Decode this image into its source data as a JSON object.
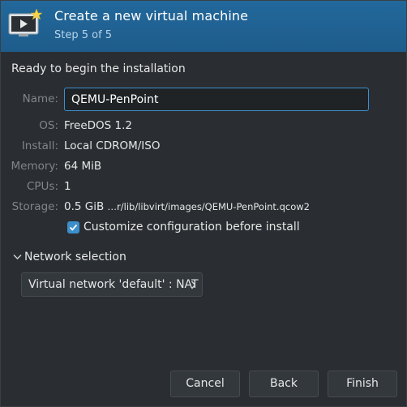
{
  "header": {
    "title": "Create a new virtual machine",
    "subtitle": "Step 5 of 5",
    "icon": "monitor-new-vm-icon"
  },
  "section_title": "Ready to begin the installation",
  "fields": {
    "name": {
      "label": "Name:",
      "value": "QEMU-PenPoint"
    },
    "os": {
      "label": "OS:",
      "value": "FreeDOS 1.2"
    },
    "install": {
      "label": "Install:",
      "value": "Local CDROM/ISO"
    },
    "memory": {
      "label": "Memory:",
      "value": "64 MiB"
    },
    "cpus": {
      "label": "CPUs:",
      "value": "1"
    },
    "storage": {
      "label": "Storage:",
      "size": "0.5 GiB",
      "path": "…r/lib/libvirt/images/QEMU-PenPoint.qcow2"
    }
  },
  "customize": {
    "label": "Customize configuration before install",
    "checked": true
  },
  "network": {
    "expander_label": "Network selection",
    "selected": "Virtual network 'default' : NAT"
  },
  "buttons": {
    "cancel": "Cancel",
    "back": "Back",
    "finish": "Finish"
  },
  "colors": {
    "header_bg": "#1e5c8b",
    "accent": "#3d8fcb",
    "background": "#2a2e32"
  }
}
